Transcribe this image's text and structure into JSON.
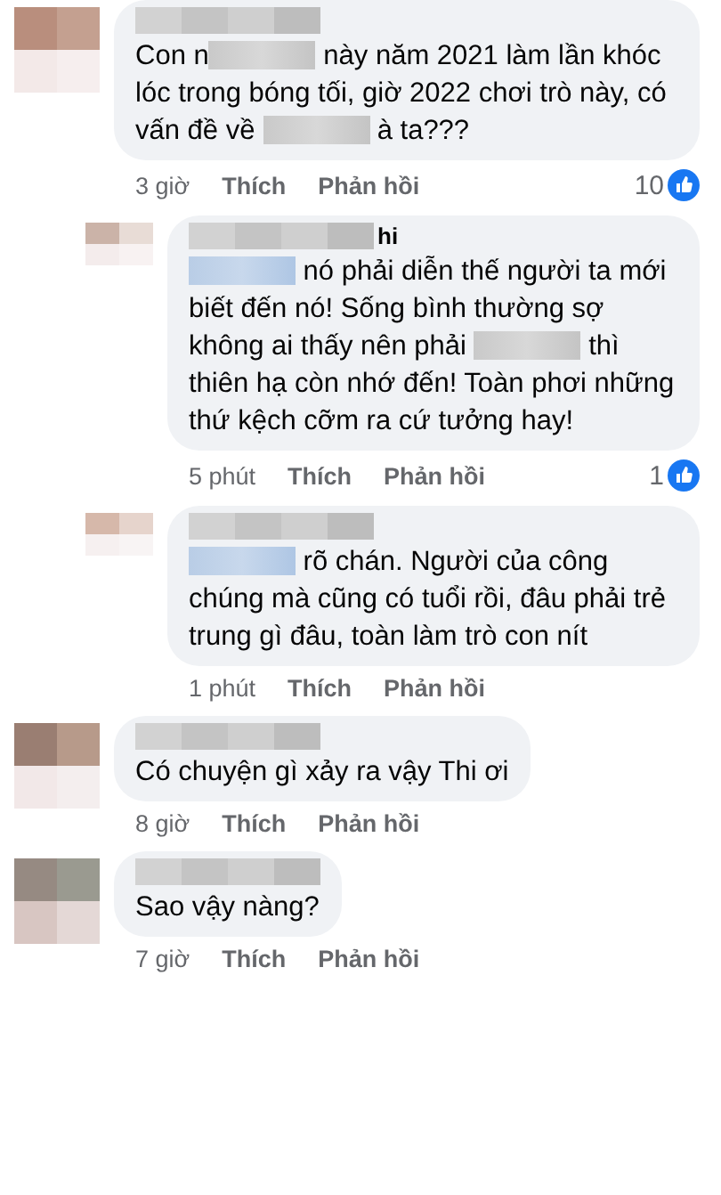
{
  "comments": [
    {
      "reply": false,
      "segments": [
        {
          "kind": "text",
          "text": "Con n"
        },
        {
          "kind": "redacted",
          "link": false
        },
        {
          "kind": "text",
          "text": " này năm 2021 làm lần khóc lóc trong bóng tối, giờ 2022 chơi trò này, có vấn đề về "
        },
        {
          "kind": "redacted",
          "link": false
        },
        {
          "kind": "text",
          "text": " à ta???"
        }
      ],
      "time": "3 giờ",
      "like": "Thích",
      "reply_label": "Phản hồi",
      "reactions": "10"
    },
    {
      "reply": true,
      "name_visible": "hi",
      "segments": [
        {
          "kind": "redacted",
          "link": true
        },
        {
          "kind": "text",
          "text": " nó phải diễn thế người ta mới biết đến nó! Sống bình thường sợ không ai thấy nên phải "
        },
        {
          "kind": "redacted",
          "link": false
        },
        {
          "kind": "text",
          "text": " thì thiên hạ còn nhớ đến! Toàn phơi những thứ kệch cỡm ra cứ tưởng hay!"
        }
      ],
      "time": "5 phút",
      "like": "Thích",
      "reply_label": "Phản hồi",
      "reactions": "1"
    },
    {
      "reply": true,
      "segments": [
        {
          "kind": "redacted",
          "link": true
        },
        {
          "kind": "text",
          "text": " rõ chán. Người của công chúng mà cũng có tuổi rồi, đâu phải trẻ trung gì đâu, toàn làm trò con nít"
        }
      ],
      "time": "1 phút",
      "like": "Thích",
      "reply_label": "Phản hồi"
    },
    {
      "reply": false,
      "segments": [
        {
          "kind": "text",
          "text": "Có chuyện gì xảy ra vậy Thi ơi"
        }
      ],
      "time": "8 giờ",
      "like": "Thích",
      "reply_label": "Phản hồi"
    },
    {
      "reply": false,
      "segments": [
        {
          "kind": "text",
          "text": "Sao vậy nàng?"
        }
      ],
      "time": "7 giờ",
      "like": "Thích",
      "reply_label": "Phản hồi"
    }
  ]
}
